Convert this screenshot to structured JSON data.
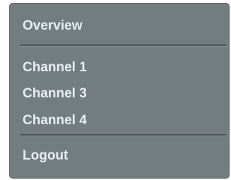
{
  "menu": {
    "overview": "Overview",
    "channels": [
      "Channel 1",
      "Channel 3",
      "Channel 4"
    ],
    "logout": "Logout"
  }
}
